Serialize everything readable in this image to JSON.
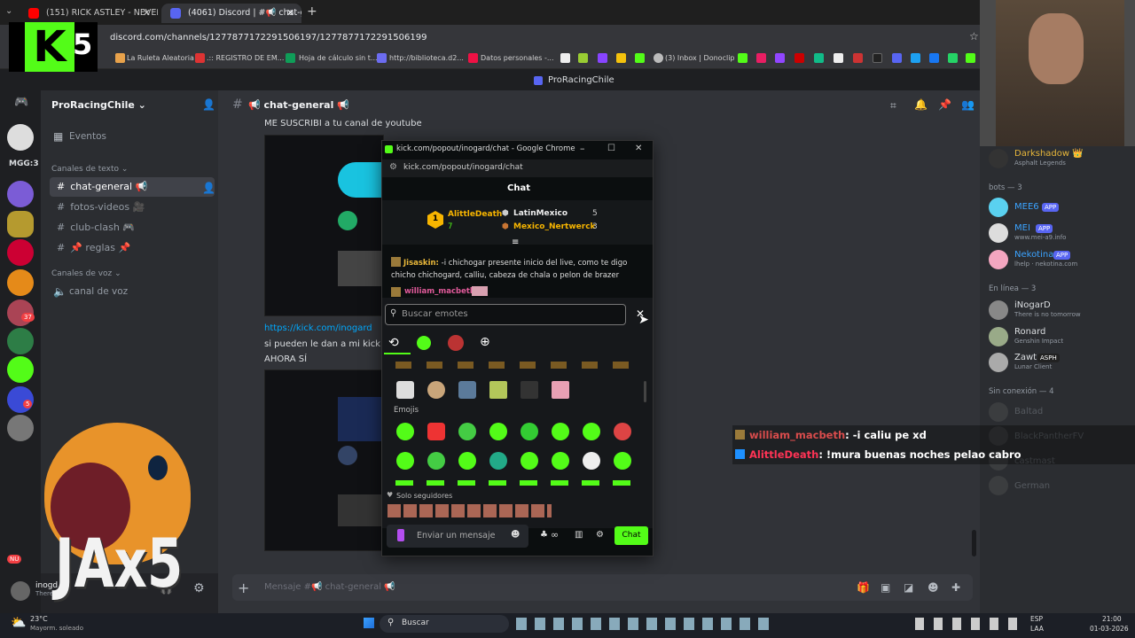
{
  "browser": {
    "tabs": [
      {
        "label": "(151) RICK ASTLEY - NEVER GO"
      },
      {
        "label": "(4061) Discord | #📢 chat-gener"
      }
    ],
    "new_tab": "+",
    "url": "discord.com/channels/1277877172291506197/1277877172291506199",
    "bookmarks": [
      "La Ruleta Aleatoria",
      ".:: REGISTRO DE EM...",
      "Hoja de cálculo sin t...",
      "http://biblioteca.d2...",
      "Datos personales -...",
      "(3) Inbox | Donoclip"
    ]
  },
  "window_title": "ProRacingChile",
  "server": {
    "name": "ProRacingChile ⌄",
    "events": "Eventos",
    "text_section": "Canales de texto ⌄",
    "voice_section": "Canales de voz ⌄",
    "channels": [
      "chat-general 📢",
      "fotos-videos 🎥",
      "club-clash 🎮",
      "📌 reglas 📌"
    ],
    "voice_channel": "canal de voz"
  },
  "guild_labels": {
    "mgg": "MGG:3",
    "badge1": "37",
    "badge2": "5",
    "nuevo": "NU"
  },
  "channel_header": {
    "hash": "#",
    "title": "📢 chat-general 📢"
  },
  "messages": {
    "line1": "ME SUSCRIBI a tu canal de youtube",
    "link": "https://kick.com/inogard",
    "line2": "si pueden le dan a mi kick. yo",
    "line3": "AHORA SÍ"
  },
  "message_placeholder": "Mensaje #📢 chat-general 📢",
  "members": {
    "top": {
      "name": "Darkshadow 👑",
      "status": "Asphalt Legends"
    },
    "bots_header": "bots — 3",
    "bots": [
      {
        "name": "MEE6",
        "tag": "APP",
        "status": ""
      },
      {
        "name": "MEI",
        "tag": "APP",
        "status": "www.mei-a9.info"
      },
      {
        "name": "Nekotina",
        "tag": "APP",
        "status": "lhelp · nekotina.com"
      }
    ],
    "online_header": "En línea — 3",
    "online": [
      {
        "name": "iNogarD",
        "status": "There is no tomorrow"
      },
      {
        "name": "Ronard",
        "status": "Genshin Impact"
      },
      {
        "name": "Zawt",
        "tag": "ASPH",
        "status": "Lunar Client"
      }
    ],
    "offline_header": "Sin conexión — 4",
    "offline": [
      {
        "name": "Baltad"
      },
      {
        "name": "BlackPantherFV"
      },
      {
        "name": "castmast"
      },
      {
        "name": "German"
      }
    ]
  },
  "user_panel": {
    "name": "inogd",
    "status": "There is"
  },
  "popup": {
    "title": "kick.com/popout/inogard/chat - Google Chrome",
    "url": "kick.com/popout/inogard/chat",
    "header": "Chat",
    "leader1": {
      "rank": "1",
      "name": "AlittleDeath",
      "count": "7"
    },
    "leader2": {
      "name": "LatinMexico",
      "count": "5"
    },
    "leader3": {
      "name": "Mexico_Nertwerck",
      "count": "3"
    },
    "chat1_user": "Jisaskin:",
    "chat1_text": "-i chichogar presente inicio del live, como te digo chicho chichogard, calliu, cabeza de chala o pelon de brazer",
    "chat2_user": "william_macbeth:",
    "search_placeholder": "Buscar emotes",
    "section_emojis": "Emojis",
    "followers_label": "Solo seguidores",
    "input_placeholder": "Enviar un mensaje",
    "send": "Chat"
  },
  "overlay_chat": [
    {
      "user": "william_macbeth",
      "text": ": -i caliu pe xd",
      "color": "#d94c4c"
    },
    {
      "user": "AlittleDeath",
      "text": ": !mura buenas noches pelao cabro",
      "color": "#ff3355"
    }
  ],
  "stream_logo": {
    "letter": "K",
    "num": "5"
  },
  "gif_text": "JAx5",
  "taskbar": {
    "weather_temp": "23°C",
    "weather_text": "Mayorm. soleado",
    "search": "Buscar",
    "lang1": "ESP",
    "lang2": "LAA",
    "time": "21:00",
    "date": "01-03-2026"
  },
  "colors": {
    "kick_green": "#53fc18",
    "discord_bg": "#313338",
    "blurple": "#5865f2"
  }
}
